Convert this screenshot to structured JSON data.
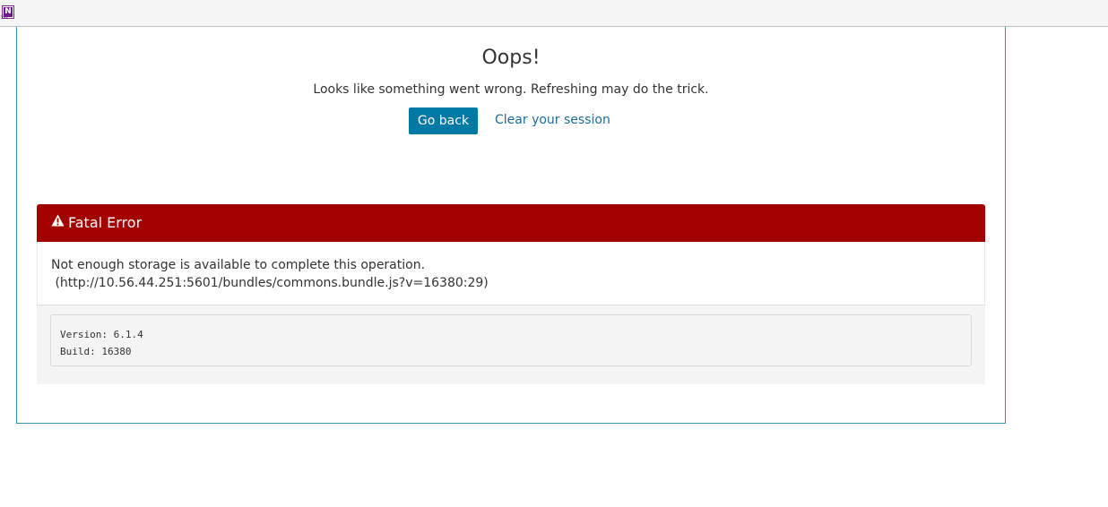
{
  "app": {
    "icon": "onenote-icon",
    "icon_letter": "N",
    "icon_sub": "S6"
  },
  "error_page": {
    "title": "Oops!",
    "subtitle": "Looks like something went wrong. Refreshing may do the trick.",
    "go_back_label": "Go back",
    "clear_session_label": "Clear your session"
  },
  "fatal_error": {
    "header_label": "Fatal Error",
    "header_icon": "warning-triangle-icon",
    "message": "Not enough storage is available to complete this operation.",
    "source": " (http://10.56.44.251:5601/bundles/commons.bundle.js?v=16380:29)",
    "version_line": "Version: 6.1.4",
    "build_line": "Build: 16380"
  },
  "colors": {
    "fatal_header_bg": "#a30000",
    "primary_button_bg": "#0079a5",
    "link": "#1b6d9b",
    "frame_border": "#3f8fb7"
  }
}
